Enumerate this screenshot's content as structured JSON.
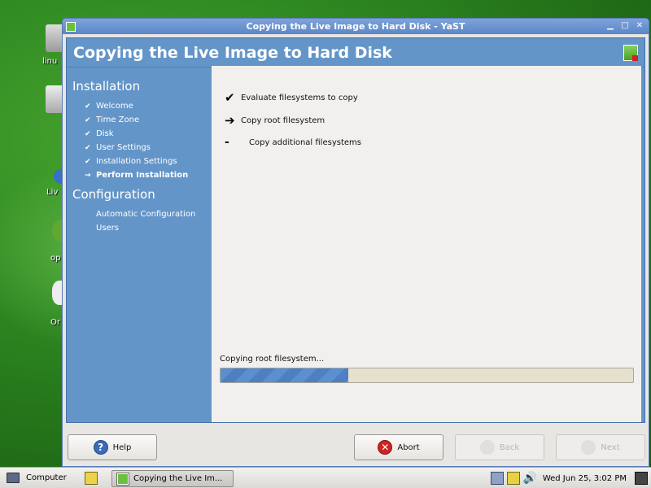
{
  "window": {
    "title": "Copying the Live Image to Hard Disk - YaST",
    "controls": [
      "minimize",
      "maximize",
      "close"
    ]
  },
  "header": {
    "title": "Copying the Live Image to Hard Disk"
  },
  "sidebar": {
    "section1": "Installation",
    "items": [
      {
        "label": "Welcome",
        "mark": "✔"
      },
      {
        "label": "Time Zone",
        "mark": "✔"
      },
      {
        "label": "Disk",
        "mark": "✔"
      },
      {
        "label": "User Settings",
        "mark": "✔"
      },
      {
        "label": "Installation Settings",
        "mark": "✔"
      },
      {
        "label": "Perform Installation",
        "mark": "→"
      }
    ],
    "section2": "Configuration",
    "config_items": [
      {
        "label": "Automatic Configuration"
      },
      {
        "label": "Users"
      }
    ]
  },
  "steps": [
    {
      "label": "Evaluate filesystems to copy",
      "symbol": "✔"
    },
    {
      "label": "Copy root filesystem",
      "symbol": "➔"
    },
    {
      "label": "Copy additional filesystems",
      "symbol": "-"
    }
  ],
  "progress": {
    "label": "Copying root filesystem...",
    "fraction": 0.31
  },
  "buttons": {
    "help": "Help",
    "abort": "Abort",
    "back": "Back",
    "next": "Next"
  },
  "taskbar": {
    "computer": "Computer",
    "task": "Copying the Live Im...",
    "clock": "Wed Jun 25,  3:02 PM"
  },
  "desktop_icons": {
    "first": "linu",
    "third": "Liv",
    "fourth": "op",
    "fifth": "Or"
  },
  "colors": {
    "title_bar": "#5b86c8",
    "header_bg": "#6495c8",
    "progress_fill": "#5c8fd0",
    "abort_icon": "#d02424",
    "help_icon": "#3a6ab8"
  }
}
